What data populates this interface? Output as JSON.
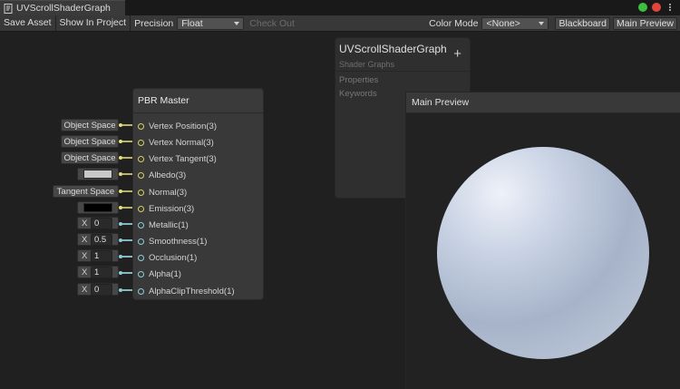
{
  "window": {
    "tab_title": "UVScrollShaderGraph",
    "tab_icon": "shadergraph-icon"
  },
  "toolbar": {
    "save_asset": "Save Asset",
    "show_in_project": "Show In Project",
    "precision_label": "Precision",
    "precision_value": "Float",
    "check_out": "Check Out",
    "color_mode_label": "Color Mode",
    "color_mode_value": "<None>",
    "blackboard": "Blackboard",
    "main_preview": "Main Preview"
  },
  "pbr_master": {
    "title": "PBR Master",
    "ports": [
      {
        "label": "Vertex Position(3)",
        "type": "vector"
      },
      {
        "label": "Vertex Normal(3)",
        "type": "vector"
      },
      {
        "label": "Vertex Tangent(3)",
        "type": "vector"
      },
      {
        "label": "Albedo(3)",
        "type": "vector"
      },
      {
        "label": "Normal(3)",
        "type": "vector"
      },
      {
        "label": "Emission(3)",
        "type": "vector"
      },
      {
        "label": "Metallic(1)",
        "type": "float"
      },
      {
        "label": "Smoothness(1)",
        "type": "float"
      },
      {
        "label": "Occlusion(1)",
        "type": "float"
      },
      {
        "label": "Alpha(1)",
        "type": "float"
      },
      {
        "label": "AlphaClipThreshold(1)",
        "type": "float"
      }
    ]
  },
  "inputs": {
    "vertex_position": "Object Space",
    "vertex_normal": "Object Space",
    "vertex_tangent": "Object Space",
    "albedo_color": "#c8c8c8",
    "normal": "Tangent Space",
    "emission_color": "#000000",
    "x_label": "X",
    "metallic": "0",
    "smoothness": "0.5",
    "occlusion": "1",
    "alpha": "1",
    "alpha_clip": "0"
  },
  "blackboard": {
    "title": "UVScrollShaderGraph",
    "subtitle": "Shader Graphs",
    "properties": "Properties",
    "keywords": "Keywords"
  },
  "main_preview": {
    "title": "Main Preview"
  },
  "colors": {
    "vector_port": "#d6d265",
    "float_port": "#8ccfd8",
    "sphere_light": "#dfe6f2",
    "sphere_dark": "#8a98b0"
  }
}
